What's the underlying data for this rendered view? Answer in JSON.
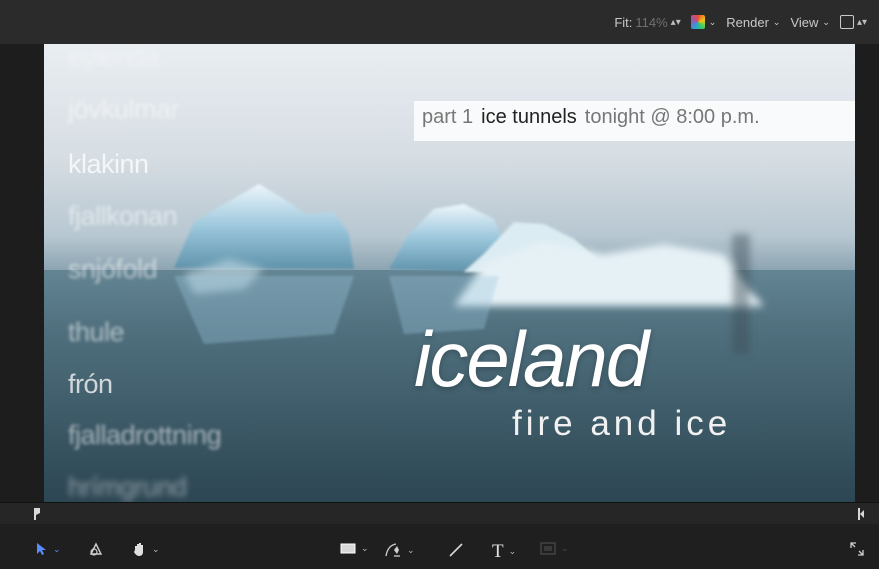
{
  "toolbar": {
    "fit_label": "Fit:",
    "fit_value": "114%",
    "render_label": "Render",
    "view_label": "View"
  },
  "canvas": {
    "scroll_words": [
      "eylenda",
      "jövkulmar",
      "klakinn",
      "fjallkonan",
      "snjófold",
      "thule",
      "frón",
      "fjalladrottning",
      "hrímgrund"
    ],
    "lower_third": {
      "part": "part 1",
      "topic": "ice tunnels",
      "time": "tonight @ 8:00 p.m."
    },
    "title": "iceland",
    "subtitle": "fire and ice"
  },
  "icons": {
    "select_tool": "arrow-pointer-icon",
    "transform_tool": "shape-transform-icon",
    "pan_tool": "hand-icon",
    "rectangle_tool": "rectangle-icon",
    "pen_tool": "pen-icon",
    "paint_tool": "brush-icon",
    "text_tool": "text-icon",
    "mask_tool": "mask-icon",
    "fullscreen": "expand-icon"
  },
  "colors": {
    "accent": "#5b8cff",
    "toolbar_bg": "#2b2b2b"
  }
}
